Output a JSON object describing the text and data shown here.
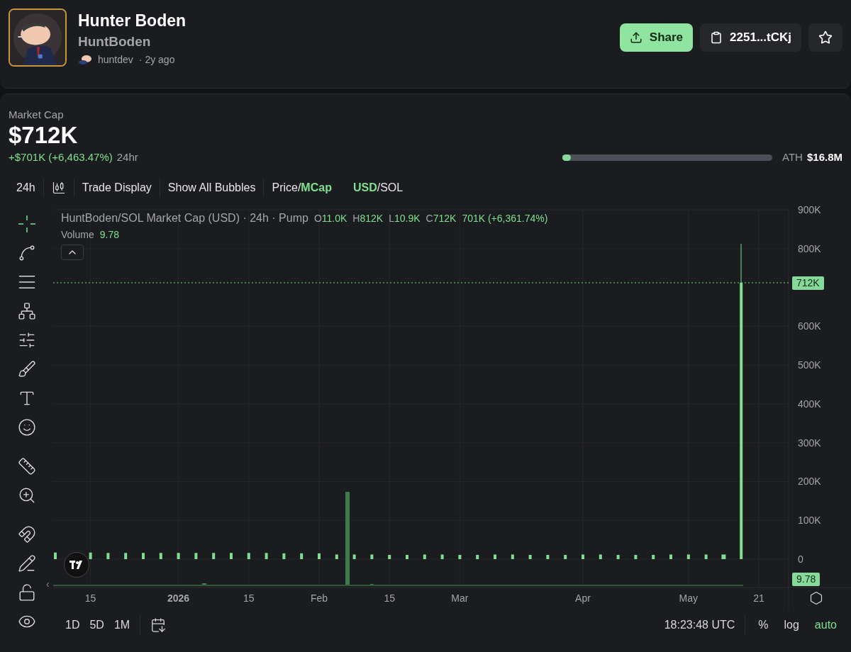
{
  "token": {
    "name": "Hunter Boden",
    "ticker": "HuntBoden",
    "creator": "huntdev",
    "age": "· 2y ago"
  },
  "actions": {
    "share": "Share",
    "address": "2251...tCKj",
    "favorited": false
  },
  "market_cap": {
    "label": "Market Cap",
    "value": "$712K",
    "change": "+$701K (+6,463.47%)",
    "period": "24hr",
    "ath_label": "ATH",
    "ath_value": "$16.8M",
    "level": 0.04
  },
  "toolbar": {
    "interval": "24h",
    "items": [
      "Trade Display",
      "Show All Bubbles"
    ],
    "toggles": [
      {
        "separator": "/",
        "options": [
          {
            "label": "Price",
            "selected": false
          },
          {
            "label": "MCap",
            "selected": true
          }
        ]
      },
      {
        "separator": "/",
        "options": [
          {
            "label": "USD",
            "selected": true
          },
          {
            "label": "SOL",
            "selected": false
          }
        ]
      }
    ]
  },
  "tools": [
    {
      "kind": "crosshair",
      "selected": true
    },
    {
      "kind": "line",
      "selected": false
    },
    {
      "kind": "fib",
      "selected": false
    },
    {
      "kind": "pattern",
      "selected": false
    },
    {
      "kind": "projection",
      "selected": false
    },
    {
      "kind": "brush",
      "selected": false
    },
    {
      "kind": "text",
      "selected": false
    },
    {
      "kind": "emoji",
      "selected": false
    },
    {
      "kind": "ruler",
      "selected": false
    },
    {
      "kind": "zoom",
      "selected": false
    },
    {
      "kind": "magnet",
      "selected": false
    },
    {
      "kind": "draw-lock",
      "selected": false
    },
    {
      "kind": "lock",
      "selected": false
    },
    {
      "kind": "eye",
      "selected": false
    }
  ],
  "legend": {
    "title": "HuntBoden/SOL Market Cap (USD) · 24h · Pump",
    "ohlc": [
      {
        "key": "O",
        "value": "11.0K"
      },
      {
        "key": "H",
        "value": "812K"
      },
      {
        "key": "L",
        "value": "10.9K"
      },
      {
        "key": "C",
        "value": "712K"
      }
    ],
    "change": "701K (+6,361.74%)",
    "volume_label": "Volume",
    "volume_value": "9.78"
  },
  "price_badge": "712K",
  "volume_badge": "9.78",
  "collapse_arrow": "‹",
  "chart_data": {
    "type": "bar",
    "grid": true,
    "ylim": [
      0,
      900000
    ],
    "ref_lines": [
      {
        "axis": "y",
        "value": 712000
      }
    ],
    "yticks": [
      {
        "value": 0,
        "label": "0"
      },
      {
        "value": 100000,
        "label": "100K"
      },
      {
        "value": 200000,
        "label": "200K"
      },
      {
        "value": 300000,
        "label": "300K"
      },
      {
        "value": 400000,
        "label": "400K"
      },
      {
        "value": 500000,
        "label": "500K"
      },
      {
        "value": 600000,
        "label": "600K"
      },
      {
        "value": 800000,
        "label": "800K"
      },
      {
        "value": 900000,
        "label": "900K"
      }
    ],
    "categories": [
      null,
      null,
      "15",
      null,
      null,
      null,
      null,
      "2026",
      null,
      null,
      null,
      "15",
      null,
      null,
      null,
      "Feb",
      null,
      null,
      null,
      "15",
      null,
      null,
      null,
      "Mar",
      null,
      null,
      null,
      null,
      null,
      null,
      "Apr",
      null,
      null,
      null,
      null,
      null,
      "May",
      null,
      null,
      null,
      "21"
    ],
    "series": [
      {
        "color": "#7ee08f",
        "values": [
          17000,
          null,
          17000,
          16000,
          16000,
          16000,
          16000,
          16000,
          16000,
          16000,
          16000,
          16000,
          16000,
          15000,
          15000,
          15000,
          12000,
          12000,
          12000,
          11000,
          11000,
          12000,
          12000,
          11000,
          11000,
          12000,
          12000,
          11000,
          11000,
          11000,
          12000,
          12000,
          11000,
          11000,
          11000,
          12000,
          12000,
          12000,
          12000,
          712000,
          null
        ]
      }
    ]
  },
  "bottom": {
    "ranges": [
      "1D",
      "5D",
      "1M"
    ],
    "time": "18:23:48 UTC",
    "scales": [
      {
        "label": "%",
        "on": false
      },
      {
        "label": "log",
        "on": false
      },
      {
        "label": "auto",
        "on": true
      }
    ]
  }
}
